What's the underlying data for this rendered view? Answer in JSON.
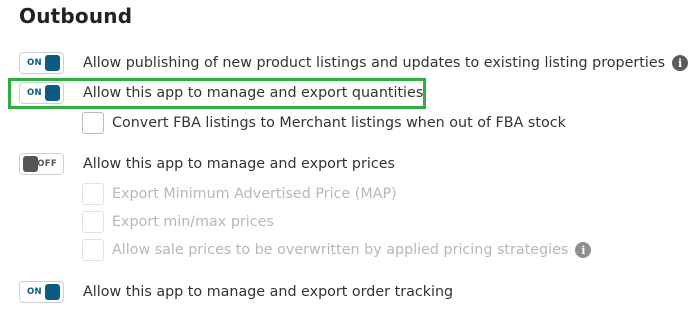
{
  "section": {
    "title": "Outbound"
  },
  "toggles": {
    "on_text": "ON",
    "off_text": "OFF"
  },
  "settings": {
    "publish_listings": {
      "state": "on",
      "label": "Allow publishing of new product listings and updates to existing listing properties"
    },
    "manage_quantities": {
      "state": "on",
      "label": "Allow this app to manage and export quantities"
    },
    "convert_fba": {
      "checked": false,
      "label": "Convert FBA listings to Merchant listings when out of FBA stock"
    },
    "manage_prices": {
      "state": "off",
      "label": "Allow this app to manage and export prices"
    },
    "export_map": {
      "checked": false,
      "disabled": true,
      "label": "Export Minimum Advertised Price (MAP)"
    },
    "export_minmax": {
      "checked": false,
      "disabled": true,
      "label": "Export min/max prices"
    },
    "sale_prices": {
      "checked": false,
      "disabled": true,
      "label": "Allow sale prices to be overwritten by applied pricing strategies"
    },
    "order_tracking": {
      "state": "on",
      "label": "Allow this app to manage and export order tracking"
    }
  },
  "icons": {
    "info": "i"
  },
  "colors": {
    "toggle_on": "#0d5a82",
    "toggle_off": "#555555",
    "highlight": "#2fae3f",
    "disabled_text": "#b3b8bd"
  }
}
